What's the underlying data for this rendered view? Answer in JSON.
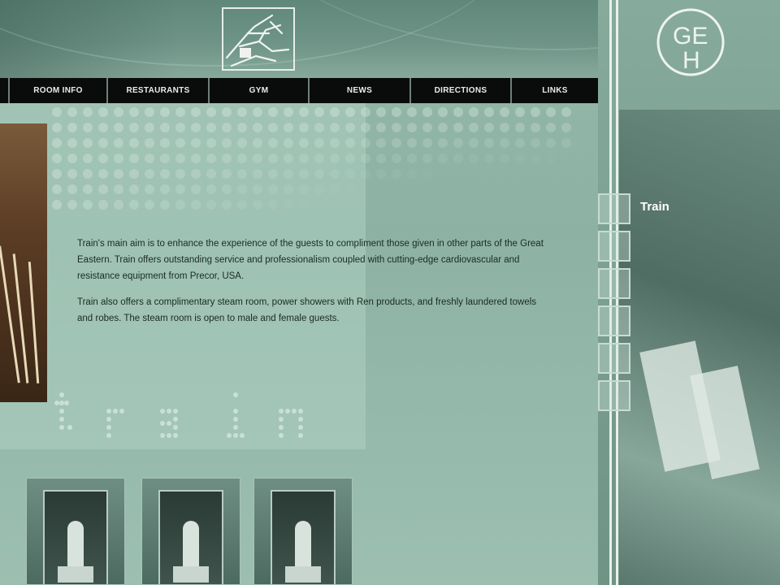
{
  "nav": {
    "items": [
      {
        "label": "ROOM INFO"
      },
      {
        "label": "RESTAURANTS"
      },
      {
        "label": "GYM"
      },
      {
        "label": "NEWS"
      },
      {
        "label": "DIRECTIONS"
      },
      {
        "label": "LINKS"
      }
    ]
  },
  "sidebar": {
    "logo_text": "GEH",
    "current_section": "Train",
    "subnav_count": 6
  },
  "content": {
    "paragraphs": [
      "Train's main aim is to enhance the experience of the guests to compliment those given in other parts of the Great Eastern. Train offers outstanding service and professionalism coupled with cutting-edge cardiovascular and resistance equipment from Precor, USA.",
      "Train also offers a complimentary steam room, power showers with Ren products, and freshly laundered towels and robes. The steam room is open to male and female guests."
    ],
    "dot_word": "train"
  },
  "colors": {
    "nav_bg": "#0a0c0b",
    "page_bg": "#8fb3a5",
    "accent_light": "#e9f0ec"
  }
}
